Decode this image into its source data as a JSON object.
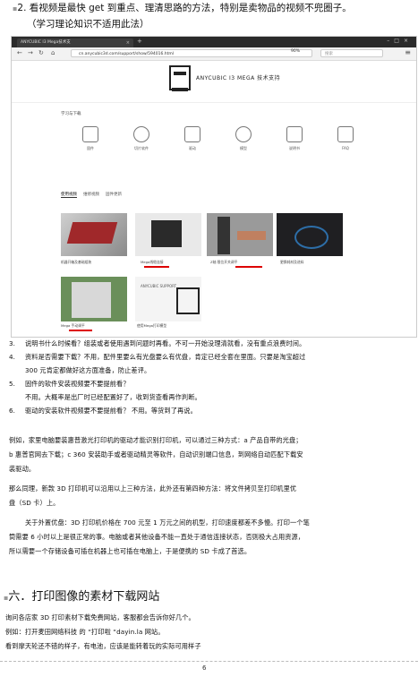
{
  "heading2": {
    "line1": "2.  看视频是最快 get 到重点、理清思路的方法，特别是卖物品的视频不兜圈子。",
    "line2": "（学习理论知识不适用此法）"
  },
  "browser": {
    "tab_title": "ANYCUBIC I3 Mega技术支",
    "url": "cn.anycubic3d.com/support/show/594016.html",
    "zoom": "90%",
    "search_placeholder": "搜索",
    "site_title": "ANYCUBIC I3 MEGA 技术支持",
    "section_label": "学习与下载",
    "features": [
      {
        "label": "固件",
        "icon": "chip-icon"
      },
      {
        "label": "切片软件",
        "icon": "layers-icon"
      },
      {
        "label": "驱动",
        "icon": "print-icon"
      },
      {
        "label": "模型",
        "icon": "model-icon"
      },
      {
        "label": "说明书",
        "icon": "book-icon"
      },
      {
        "label": "FAQ",
        "icon": "faq-icon"
      }
    ],
    "subtabs": [
      "使用视频",
      "维修视频",
      "固件更新"
    ],
    "thumb_captions": [
      "机器开箱及基础组装",
      "Mega线缆连接",
      "Z轴 限位开关调平",
      "更换耗材及进料",
      "Mega 手动调平",
      "使用Mega打印模型"
    ],
    "support_badge": "ANYCUBIC SUPPORT"
  },
  "items": [
    {
      "num": "3.",
      "text": "说明书什么时候看？组装或者使用遇到问题时再看。不可一开始没理清就看，没有重点浪费时间。"
    },
    {
      "num": "4.",
      "text": "资料是否需要下载？不用，配件里要么有光盘要么有优盘，肯定已经全套在里面。只要是淘宝超过"
    },
    {
      "num": "",
      "text": "300 元肯定都做好这方面准备，防止差评。"
    },
    {
      "num": "5.",
      "text": "固件的软件安装视频要不要提前看？"
    },
    {
      "num": "",
      "text": "不用。大概率是出厂时已经配置好了，收到货查看再作判断。"
    },
    {
      "num": "6.",
      "text": "驱动的安装软件视频要不要提前看？  不用。等货到了再说。"
    }
  ],
  "para1": [
    "例如，家里电脑要装惠普激光打印机的驱动才能识别打印机，可以通过三种方式：a 产品自带的光盘；",
    "b 惠普官网去下载；c 360 安装助手或者驱动精灵等软件，自动识别端口信息，到网络自动匹配下载安",
    "装驱动。"
  ],
  "para2": [
    "那么同理，新款 3D 打印机可以沿用以上三种方法，此外还有第四种方法：将文件拷贝至打印机里优",
    "盘（SD 卡）上。"
  ],
  "para3": [
    "关于外置优盘：3D 打印机价格在 700 元至 1 万元之间的机型，打印速度都差不多慢。打印一个笔",
    "筒需要 6 小时以上是很正常的事。电脑或者其他设备不能一直处于通信连接状态，否则极大占用资源，",
    "所以需要一个存储设备可插在机器上也可插在电脑上，于是便携的 SD 卡成了首选。"
  ],
  "heading6": "六．打印图像的素材下载网站",
  "para4": [
    "询问各店家 3D 打印素材下载免费网站，客服都会告诉你好几个。",
    "例如：打开麦田网络科技 的 “打印啦 “dayin.la 网站。",
    "看到摩天轮还不错的样子，有电池，应该是能转着玩的实际可用样子"
  ],
  "page_number": "6"
}
